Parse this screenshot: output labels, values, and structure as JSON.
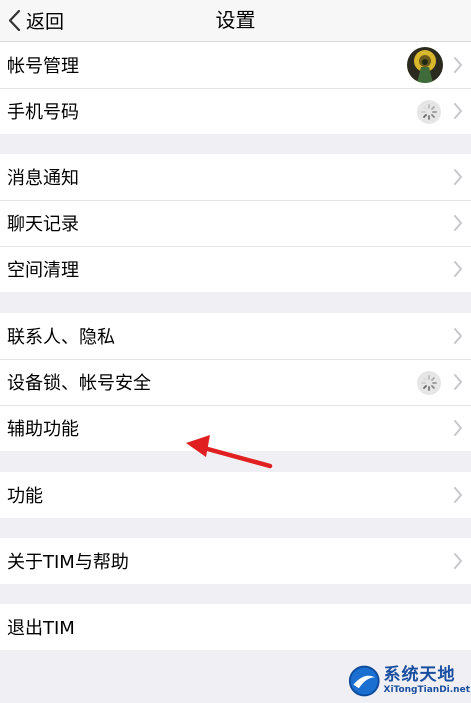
{
  "nav": {
    "back_label": "返回",
    "title": "设置"
  },
  "groups": [
    {
      "items": [
        {
          "label": "帐号管理",
          "accessory": "avatar"
        },
        {
          "label": "手机号码",
          "accessory": "spinner"
        }
      ]
    },
    {
      "items": [
        {
          "label": "消息通知"
        },
        {
          "label": "聊天记录"
        },
        {
          "label": "空间清理"
        }
      ]
    },
    {
      "items": [
        {
          "label": "联系人、隐私"
        },
        {
          "label": "设备锁、帐号安全",
          "accessory": "spinner"
        },
        {
          "label": "辅助功能"
        }
      ]
    },
    {
      "items": [
        {
          "label": "功能"
        }
      ]
    },
    {
      "items": [
        {
          "label": "关于TIM与帮助"
        }
      ]
    },
    {
      "items": [
        {
          "label": "退出TIM"
        }
      ]
    }
  ],
  "annotation": {
    "arrow_color": "#e02020"
  },
  "watermark": {
    "cn": "系统天地",
    "en": "XiTongTianDi.net"
  }
}
